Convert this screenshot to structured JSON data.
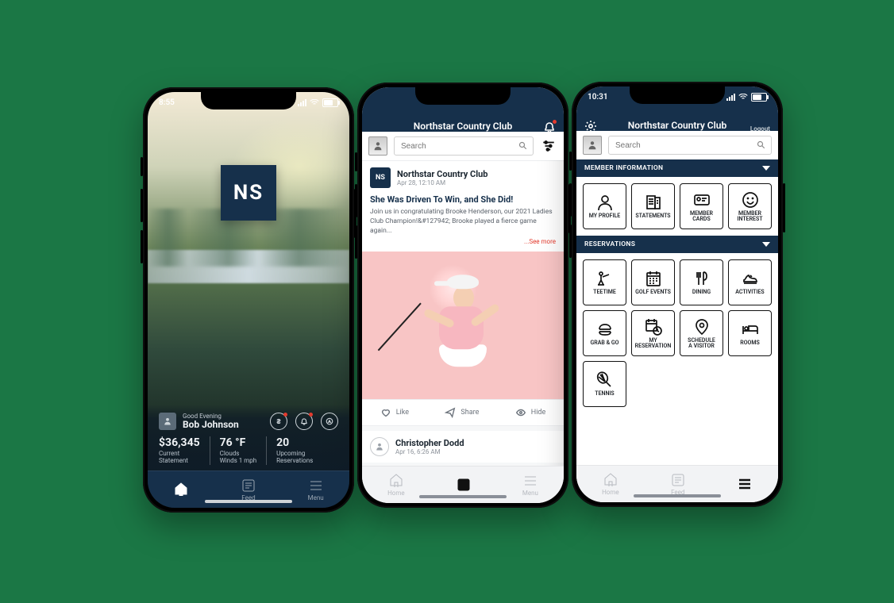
{
  "club_name": "Northstar Country Club",
  "logo_text": "NS",
  "phone1": {
    "time": "8:55",
    "greeting": "Good Evening",
    "user": "Bob Johnson",
    "stats": {
      "statement_amount": "$36,345",
      "statement_label": "Current\nStatement",
      "temp": "76 °F",
      "weather_line1": "Clouds",
      "weather_line2": "Winds 1 mph",
      "reservations_count": "20",
      "reservations_label": "Upcoming\nReservations"
    },
    "tabs": {
      "home": "",
      "feed": "Feed",
      "menu": "Menu"
    }
  },
  "phone2": {
    "title": "Northstar Country Club",
    "search_placeholder": "Search",
    "post": {
      "author": "Northstar Country Club",
      "time": "Apr 28, 12:10 AM",
      "title": "She Was Driven To Win, and She Did!",
      "text": "Join us in congratulating Brooke Henderson, our 2021 Ladies Club Champion!&#127942; Brooke played a fierce game again...",
      "see_more": "...See more",
      "like": "Like",
      "share": "Share",
      "hide": "Hide"
    },
    "post2": {
      "author": "Christopher Dodd",
      "time": "Apr 16, 6:26 AM"
    },
    "tabs": {
      "home": "Home",
      "feed": "",
      "menu": "Menu"
    }
  },
  "phone3": {
    "time": "10:31",
    "title": "Northstar Country Club",
    "logout": "Logout",
    "search_placeholder": "Search",
    "sections": {
      "member_info": "MEMBER INFORMATION",
      "reservations": "RESERVATIONS"
    },
    "tiles_info": [
      {
        "label": "MY PROFILE",
        "icon": "profile"
      },
      {
        "label": "STATEMENTS",
        "icon": "statements"
      },
      {
        "label": "MEMBER CARDS",
        "icon": "card"
      },
      {
        "label": "MEMBER INTEREST",
        "icon": "smile"
      }
    ],
    "tiles_res": [
      {
        "label": "TEETIME",
        "icon": "golf"
      },
      {
        "label": "GOLF EVENTS",
        "icon": "calendar"
      },
      {
        "label": "DINING",
        "icon": "dining"
      },
      {
        "label": "ACTIVITIES",
        "icon": "shoe"
      },
      {
        "label": "GRAB & GO",
        "icon": "burger"
      },
      {
        "label": "MY RESERVATION",
        "icon": "cal-clock"
      },
      {
        "label": "SCHEDULE A VISITOR",
        "icon": "pin"
      },
      {
        "label": "ROOMS",
        "icon": "bed"
      },
      {
        "label": "TENNIS",
        "icon": "tennis"
      }
    ],
    "tabs": {
      "home": "Home",
      "feed": "Feed",
      "menu": ""
    }
  }
}
